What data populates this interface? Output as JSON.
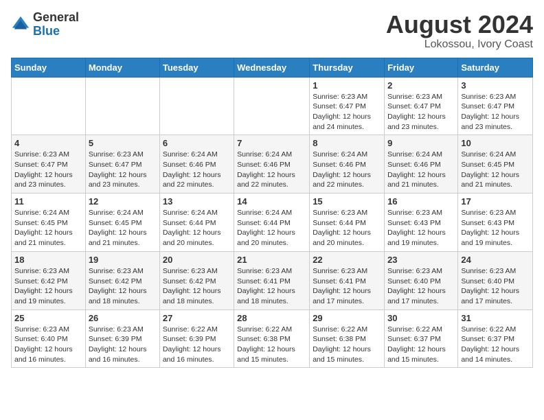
{
  "header": {
    "logo_general": "General",
    "logo_blue": "Blue",
    "month_year": "August 2024",
    "location": "Lokossou, Ivory Coast"
  },
  "days_of_week": [
    "Sunday",
    "Monday",
    "Tuesday",
    "Wednesday",
    "Thursday",
    "Friday",
    "Saturday"
  ],
  "weeks": [
    [
      {
        "day": "",
        "info": ""
      },
      {
        "day": "",
        "info": ""
      },
      {
        "day": "",
        "info": ""
      },
      {
        "day": "",
        "info": ""
      },
      {
        "day": "1",
        "info": "Sunrise: 6:23 AM\nSunset: 6:47 PM\nDaylight: 12 hours\nand 24 minutes."
      },
      {
        "day": "2",
        "info": "Sunrise: 6:23 AM\nSunset: 6:47 PM\nDaylight: 12 hours\nand 23 minutes."
      },
      {
        "day": "3",
        "info": "Sunrise: 6:23 AM\nSunset: 6:47 PM\nDaylight: 12 hours\nand 23 minutes."
      }
    ],
    [
      {
        "day": "4",
        "info": "Sunrise: 6:23 AM\nSunset: 6:47 PM\nDaylight: 12 hours\nand 23 minutes."
      },
      {
        "day": "5",
        "info": "Sunrise: 6:23 AM\nSunset: 6:47 PM\nDaylight: 12 hours\nand 23 minutes."
      },
      {
        "day": "6",
        "info": "Sunrise: 6:24 AM\nSunset: 6:46 PM\nDaylight: 12 hours\nand 22 minutes."
      },
      {
        "day": "7",
        "info": "Sunrise: 6:24 AM\nSunset: 6:46 PM\nDaylight: 12 hours\nand 22 minutes."
      },
      {
        "day": "8",
        "info": "Sunrise: 6:24 AM\nSunset: 6:46 PM\nDaylight: 12 hours\nand 22 minutes."
      },
      {
        "day": "9",
        "info": "Sunrise: 6:24 AM\nSunset: 6:46 PM\nDaylight: 12 hours\nand 21 minutes."
      },
      {
        "day": "10",
        "info": "Sunrise: 6:24 AM\nSunset: 6:45 PM\nDaylight: 12 hours\nand 21 minutes."
      }
    ],
    [
      {
        "day": "11",
        "info": "Sunrise: 6:24 AM\nSunset: 6:45 PM\nDaylight: 12 hours\nand 21 minutes."
      },
      {
        "day": "12",
        "info": "Sunrise: 6:24 AM\nSunset: 6:45 PM\nDaylight: 12 hours\nand 21 minutes."
      },
      {
        "day": "13",
        "info": "Sunrise: 6:24 AM\nSunset: 6:44 PM\nDaylight: 12 hours\nand 20 minutes."
      },
      {
        "day": "14",
        "info": "Sunrise: 6:24 AM\nSunset: 6:44 PM\nDaylight: 12 hours\nand 20 minutes."
      },
      {
        "day": "15",
        "info": "Sunrise: 6:23 AM\nSunset: 6:44 PM\nDaylight: 12 hours\nand 20 minutes."
      },
      {
        "day": "16",
        "info": "Sunrise: 6:23 AM\nSunset: 6:43 PM\nDaylight: 12 hours\nand 19 minutes."
      },
      {
        "day": "17",
        "info": "Sunrise: 6:23 AM\nSunset: 6:43 PM\nDaylight: 12 hours\nand 19 minutes."
      }
    ],
    [
      {
        "day": "18",
        "info": "Sunrise: 6:23 AM\nSunset: 6:42 PM\nDaylight: 12 hours\nand 19 minutes."
      },
      {
        "day": "19",
        "info": "Sunrise: 6:23 AM\nSunset: 6:42 PM\nDaylight: 12 hours\nand 18 minutes."
      },
      {
        "day": "20",
        "info": "Sunrise: 6:23 AM\nSunset: 6:42 PM\nDaylight: 12 hours\nand 18 minutes."
      },
      {
        "day": "21",
        "info": "Sunrise: 6:23 AM\nSunset: 6:41 PM\nDaylight: 12 hours\nand 18 minutes."
      },
      {
        "day": "22",
        "info": "Sunrise: 6:23 AM\nSunset: 6:41 PM\nDaylight: 12 hours\nand 17 minutes."
      },
      {
        "day": "23",
        "info": "Sunrise: 6:23 AM\nSunset: 6:40 PM\nDaylight: 12 hours\nand 17 minutes."
      },
      {
        "day": "24",
        "info": "Sunrise: 6:23 AM\nSunset: 6:40 PM\nDaylight: 12 hours\nand 17 minutes."
      }
    ],
    [
      {
        "day": "25",
        "info": "Sunrise: 6:23 AM\nSunset: 6:40 PM\nDaylight: 12 hours\nand 16 minutes."
      },
      {
        "day": "26",
        "info": "Sunrise: 6:23 AM\nSunset: 6:39 PM\nDaylight: 12 hours\nand 16 minutes."
      },
      {
        "day": "27",
        "info": "Sunrise: 6:22 AM\nSunset: 6:39 PM\nDaylight: 12 hours\nand 16 minutes."
      },
      {
        "day": "28",
        "info": "Sunrise: 6:22 AM\nSunset: 6:38 PM\nDaylight: 12 hours\nand 15 minutes."
      },
      {
        "day": "29",
        "info": "Sunrise: 6:22 AM\nSunset: 6:38 PM\nDaylight: 12 hours\nand 15 minutes."
      },
      {
        "day": "30",
        "info": "Sunrise: 6:22 AM\nSunset: 6:37 PM\nDaylight: 12 hours\nand 15 minutes."
      },
      {
        "day": "31",
        "info": "Sunrise: 6:22 AM\nSunset: 6:37 PM\nDaylight: 12 hours\nand 14 minutes."
      }
    ]
  ]
}
